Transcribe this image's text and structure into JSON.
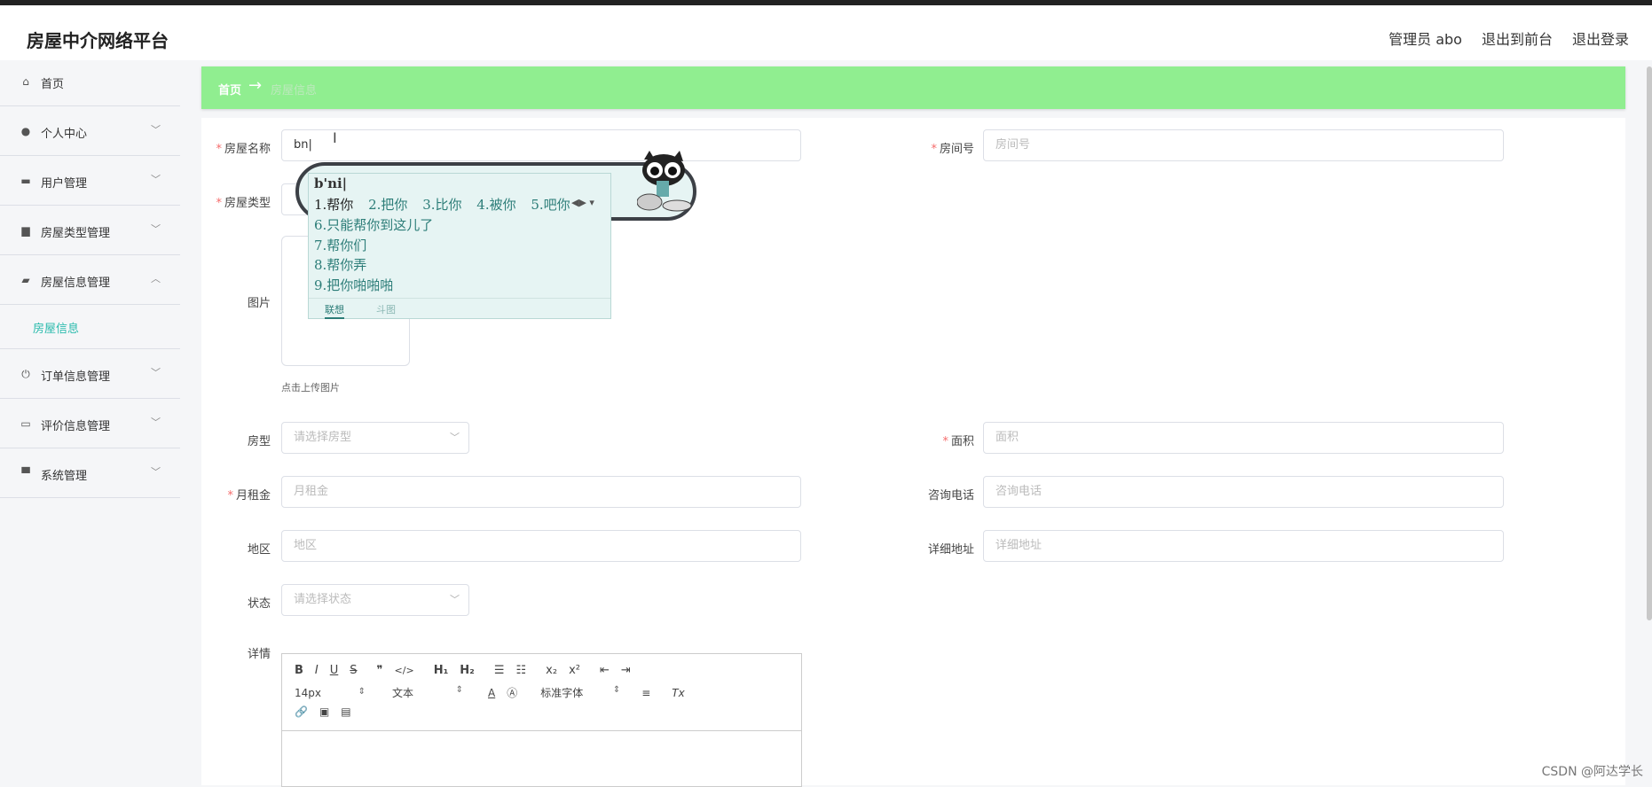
{
  "app": {
    "title": "房屋中介网络平台"
  },
  "header": {
    "user_label": "管理员 abo",
    "frontend_link": "退出到前台",
    "logout_link": "退出登录"
  },
  "sidebar": {
    "items": [
      {
        "label": "首页",
        "icon": "home-icon"
      },
      {
        "label": "个人中心",
        "icon": "user-icon"
      },
      {
        "label": "用户管理",
        "icon": "users-icon"
      },
      {
        "label": "房屋类型管理",
        "icon": "house-type-icon"
      },
      {
        "label": "房屋信息管理",
        "icon": "briefcase-icon"
      },
      {
        "label": "订单信息管理",
        "icon": "power-icon"
      },
      {
        "label": "评价信息管理",
        "icon": "review-icon"
      },
      {
        "label": "系统管理",
        "icon": "monitor-icon"
      }
    ],
    "active_sub": "房屋信息"
  },
  "breadcrumb": {
    "home": "首页",
    "arrow": "→",
    "current": "房屋信息"
  },
  "form": {
    "house_name": {
      "label": "房屋名称",
      "value": "bn"
    },
    "room_no": {
      "label": "房间号",
      "placeholder": "房间号"
    },
    "house_type": {
      "label": "房屋类型"
    },
    "image": {
      "label": "图片",
      "hint": "点击上传图片"
    },
    "layout": {
      "label": "房型",
      "placeholder": "请选择房型"
    },
    "area": {
      "label": "面积",
      "placeholder": "面积"
    },
    "rent": {
      "label": "月租金",
      "placeholder": "月租金"
    },
    "phone": {
      "label": "咨询电话",
      "placeholder": "咨询电话"
    },
    "region": {
      "label": "地区",
      "placeholder": "地区"
    },
    "address": {
      "label": "详细地址",
      "placeholder": "详细地址"
    },
    "status": {
      "label": "状态",
      "placeholder": "请选择状态"
    },
    "detail": {
      "label": "详情"
    }
  },
  "editor": {
    "font_size": "14px",
    "block_format": "文本",
    "font_family": "标准字体",
    "row1": [
      "B",
      "I",
      "U",
      "S",
      "❞",
      "</>",
      "H₁",
      "H₂",
      "☰",
      "☷",
      "x₂",
      "x²",
      "⇤",
      "⇥"
    ],
    "row2_extra": [
      "A",
      "Ⓐ",
      "≡",
      "Tx"
    ],
    "row3": [
      "🔗",
      "▣",
      "▤"
    ]
  },
  "ime": {
    "pinyin": "b'ni|",
    "candidates": [
      "1.帮你",
      "2.把你",
      "3.比你",
      "4.被你",
      "5.吧你"
    ],
    "more": [
      "6.只能帮你到这儿了",
      "7.帮你们",
      "8.帮你弄",
      "9.把你啪啪啪"
    ],
    "tab_assoc": "联想",
    "tab_meme": "斗图"
  },
  "watermark": "CSDN @阿达学长"
}
